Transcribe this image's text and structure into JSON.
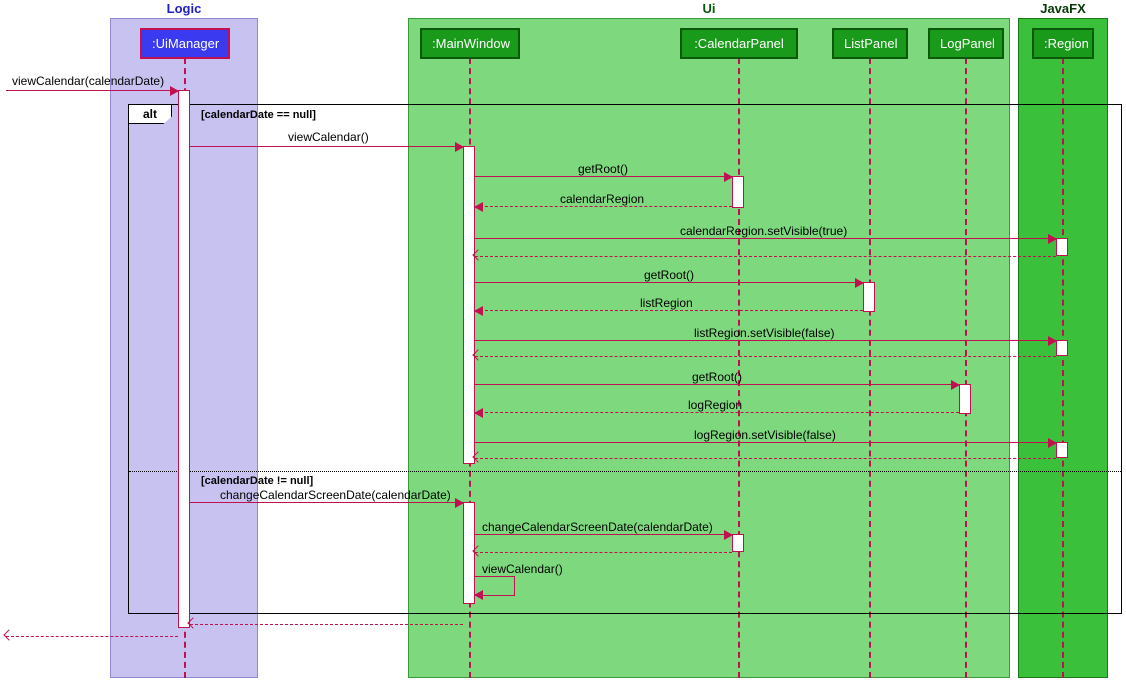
{
  "packages": {
    "logic": "Logic",
    "ui": "Ui",
    "javafx": "JavaFX"
  },
  "lifelines": {
    "uimanager": ":UiManager",
    "mainwindow": ":MainWindow",
    "calendarpanel": ":CalendarPanel",
    "listpanel": "ListPanel",
    "logpanel": "LogPanel",
    "region": ":Region"
  },
  "alt": {
    "tag": "alt",
    "guard1": "[calendarDate == null]",
    "guard2": "[calendarDate != null]"
  },
  "messages": {
    "m0": "viewCalendar(calendarDate)",
    "m1": "viewCalendar()",
    "m2": "getRoot()",
    "m3": "calendarRegion",
    "m4": "calendarRegion.setVisible(true)",
    "m5": "getRoot()",
    "m6": "listRegion",
    "m7": "listRegion.setVisible(false)",
    "m8": "getRoot()",
    "m9": "logRegion",
    "m10": "logRegion.setVisible(false)",
    "m11": "changeCalendarScreenDate(calendarDate)",
    "m12": "changeCalendarScreenDate(calendarDate)",
    "m13": "viewCalendar()"
  },
  "chart_data": {
    "type": "sequence-diagram",
    "packages": [
      {
        "name": "Logic",
        "participants": [
          ":UiManager"
        ]
      },
      {
        "name": "Ui",
        "participants": [
          ":MainWindow",
          ":CalendarPanel",
          "ListPanel",
          "LogPanel"
        ]
      },
      {
        "name": "JavaFX",
        "participants": [
          ":Region"
        ]
      }
    ],
    "entry": {
      "from": "external",
      "to": ":UiManager",
      "label": "viewCalendar(calendarDate)"
    },
    "fragments": [
      {
        "type": "alt",
        "operands": [
          {
            "guard": "calendarDate == null",
            "messages": [
              {
                "from": ":UiManager",
                "to": ":MainWindow",
                "label": "viewCalendar()",
                "kind": "sync"
              },
              {
                "from": ":MainWindow",
                "to": ":CalendarPanel",
                "label": "getRoot()",
                "kind": "sync"
              },
              {
                "from": ":CalendarPanel",
                "to": ":MainWindow",
                "label": "calendarRegion",
                "kind": "return"
              },
              {
                "from": ":MainWindow",
                "to": ":Region",
                "label": "calendarRegion.setVisible(true)",
                "kind": "sync"
              },
              {
                "from": ":Region",
                "to": ":MainWindow",
                "label": "",
                "kind": "return"
              },
              {
                "from": ":MainWindow",
                "to": "ListPanel",
                "label": "getRoot()",
                "kind": "sync"
              },
              {
                "from": "ListPanel",
                "to": ":MainWindow",
                "label": "listRegion",
                "kind": "return"
              },
              {
                "from": ":MainWindow",
                "to": ":Region",
                "label": "listRegion.setVisible(false)",
                "kind": "sync"
              },
              {
                "from": ":Region",
                "to": ":MainWindow",
                "label": "",
                "kind": "return"
              },
              {
                "from": ":MainWindow",
                "to": "LogPanel",
                "label": "getRoot()",
                "kind": "sync"
              },
              {
                "from": "LogPanel",
                "to": ":MainWindow",
                "label": "logRegion",
                "kind": "return"
              },
              {
                "from": ":MainWindow",
                "to": ":Region",
                "label": "logRegion.setVisible(false)",
                "kind": "sync"
              },
              {
                "from": ":Region",
                "to": ":MainWindow",
                "label": "",
                "kind": "return"
              }
            ]
          },
          {
            "guard": "calendarDate != null",
            "messages": [
              {
                "from": ":UiManager",
                "to": ":MainWindow",
                "label": "changeCalendarScreenDate(calendarDate)",
                "kind": "sync"
              },
              {
                "from": ":MainWindow",
                "to": ":CalendarPanel",
                "label": "changeCalendarScreenDate(calendarDate)",
                "kind": "sync"
              },
              {
                "from": ":CalendarPanel",
                "to": ":MainWindow",
                "label": "",
                "kind": "return"
              },
              {
                "from": ":MainWindow",
                "to": ":MainWindow",
                "label": "viewCalendar()",
                "kind": "self"
              }
            ]
          }
        ]
      }
    ],
    "exit": {
      "from": ":UiManager",
      "to": "external",
      "kind": "return"
    }
  }
}
